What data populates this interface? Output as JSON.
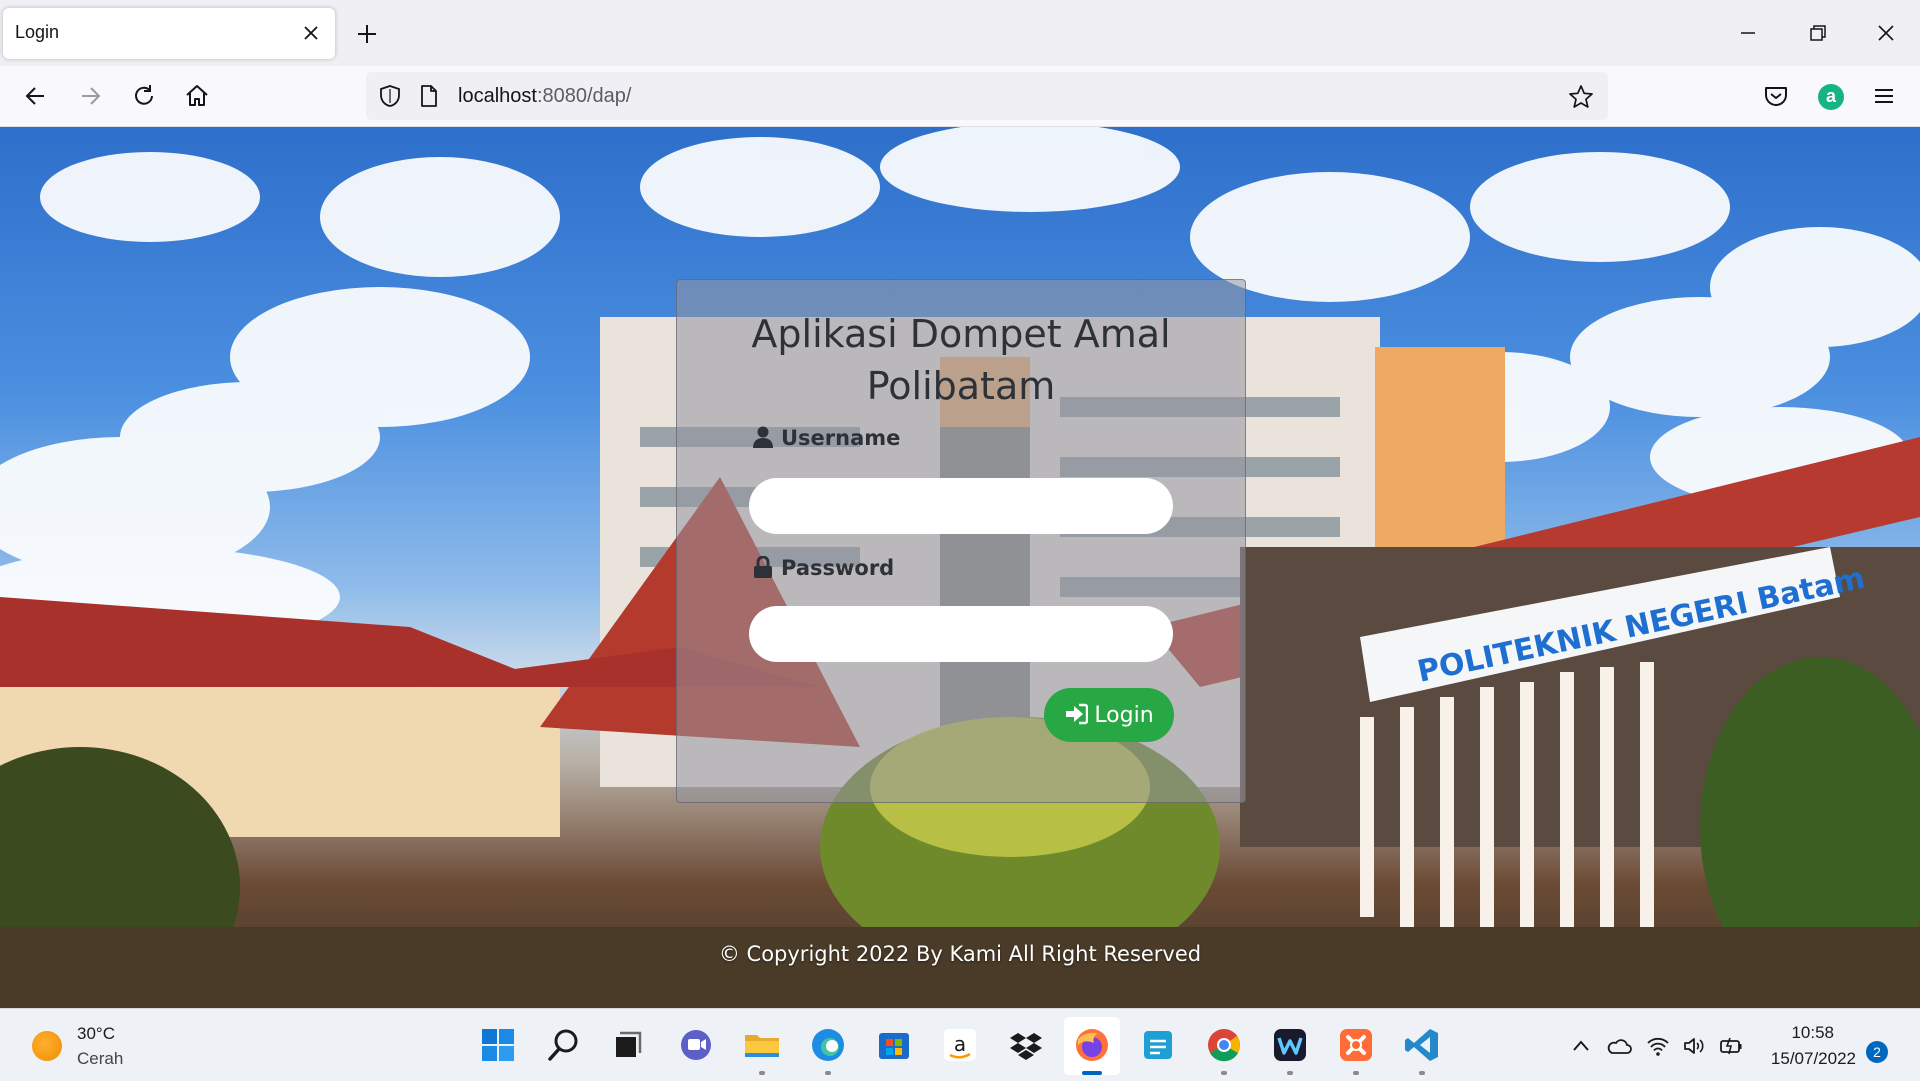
{
  "browser": {
    "tab_title": "Login",
    "url_host": "localhost",
    "url_rest": ":8080/dap/"
  },
  "page": {
    "title": "Aplikasi Dompet Amal Polibatam",
    "username_label": "Username",
    "password_label": "Password",
    "login_button": "Login",
    "copyright": "© Copyright 2022 By Kami All Right Reserved",
    "background_sign_text": "POLITEKNIK NEGERI Batam"
  },
  "taskbar": {
    "weather_temp": "30°C",
    "weather_desc": "Cerah",
    "time": "10:58",
    "date": "15/07/2022",
    "notification_count": "2",
    "apps": [
      "start-icon",
      "search-icon",
      "task-view-icon",
      "chat-icon",
      "file-explorer-icon",
      "edge-icon",
      "store-icon",
      "amazon-icon",
      "dropbox-icon",
      "firefox-icon",
      "calculator-icon",
      "chrome-icon",
      "wondershare-icon",
      "postman-icon",
      "vscode-icon"
    ]
  },
  "colors": {
    "login_button": "#28a745",
    "card_bg": "rgba(150,150,160,0.55)",
    "profile_avatar": "#16b384"
  }
}
